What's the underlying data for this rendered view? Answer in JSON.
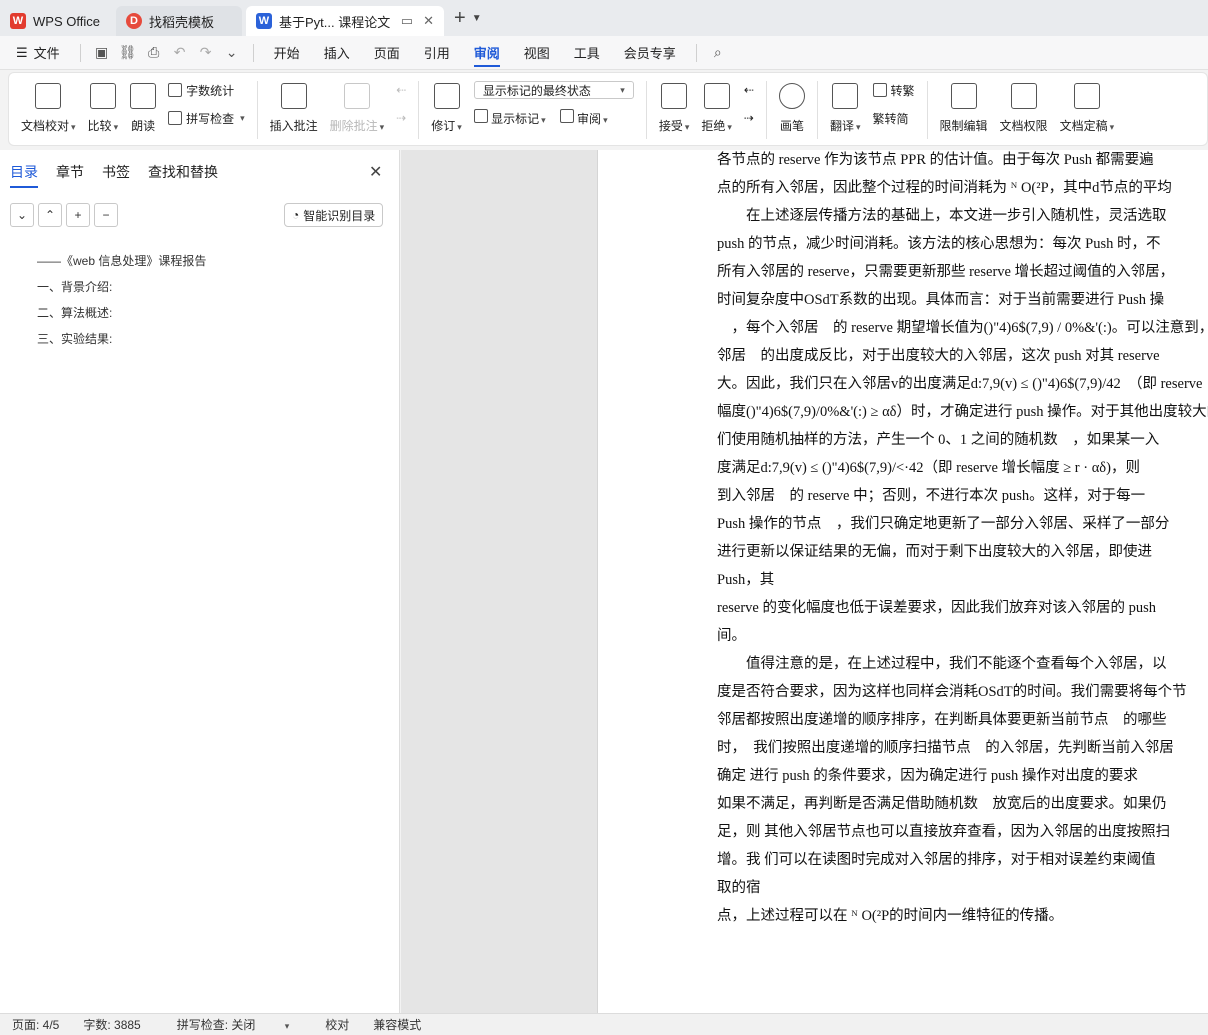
{
  "titlebar": {
    "app_tab": "WPS Office",
    "template_tab": "找稻壳模板",
    "doc_tab": "基于Pyt... 课程论文"
  },
  "menu": {
    "file": "文件",
    "items": [
      "开始",
      "插入",
      "页面",
      "引用",
      "审阅",
      "视图",
      "工具",
      "会员专享"
    ],
    "active": "审阅"
  },
  "ribbon": {
    "doc_check": "文档校对",
    "compare": "比较",
    "read_aloud": "朗读",
    "word_count": "字数统计",
    "spell_check": "拼写检查",
    "insert_comment": "插入批注",
    "delete_comment": "删除批注",
    "track_changes": "修订",
    "display_mode": "显示标记的最终状态",
    "show_markup": "显示标记",
    "reviewing_pane": "审阅",
    "accept": "接受",
    "reject": "拒绝",
    "ink": "画笔",
    "translate": "翻译",
    "to_traditional": "转繁",
    "to_simplified": "繁转简",
    "restrict_edit": "限制编辑",
    "doc_permission": "文档权限",
    "finalize": "文档定稿"
  },
  "nav_pane": {
    "tabs": [
      "目录",
      "章节",
      "书签",
      "查找和替换"
    ],
    "smart_toc": "智能识别目录",
    "toc": [
      "——《web 信息处理》课程报告",
      "一、背景介绍:",
      "二、算法概述:",
      "三、实验结果:"
    ]
  },
  "document": {
    "lines": [
      "各节点的 reserve 作为该节点 PPR 的估计值。由于每次 Push 都需要遍",
      "点的所有入邻居，因此整个过程的时间消耗为 ᴺ O(²P，其中d节点的平均",
      "　　在上述逐层传播方法的基础上，本文进一步引入随机性，灵活选取",
      "push 的节点，减少时间消耗。该方法的核心思想为：每次 Push 时，不",
      "所有入邻居的 reserve，只需要更新那些 reserve 增长超过阈值的入邻居，",
      "时间复杂度中OSdT系数的出现。具体而言：对于当前需要进行 Push 操",
      "　，每个入邻居　的 reserve 期望增长值为()\"4)6$(7,9) / 0%&'(:)。可以注意到，该增",
      "邻居　的出度成反比，对于出度较大的入邻居，这次 push 对其 reserve",
      "大。因此，我们只在入邻居v的出度满足d:7,9(v) ≤ ()\"4)6$(7,9)/42　（即 reserve",
      "幅度()\"4)6$(7,9)/0%&'(:) ≥ αδ）时，才确定进行 push 操作。对于其他出度较大的节",
      "们使用随机抽样的方法，产生一个 0、1 之间的随机数　，如果某一入",
      "度满足d:7,9(v) ≤ ()\"4)6$(7,9)/<·42（即 reserve 增长幅度 ≥ r · αδ)，则",
      "到入邻居　的 reserve 中；否则，不进行本次 push。这样，对于每一",
      "Push 操作的节点　，我们只确定地更新了一部分入邻居、采样了一部分",
      "进行更新以保证结果的无偏，而对于剩下出度较大的入邻居，即使进",
      "Push，其",
      "reserve 的变化幅度也低于误差要求，因此我们放弃对该入邻居的 push",
      "间。",
      "　　值得注意的是，在上述过程中，我们不能逐个查看每个入邻居，以",
      "度是否符合要求，因为这样也同样会消耗OSdT的时间。我们需要将每个节",
      "邻居都按照出度递增的顺序排序，在判断具体要更新当前节点　的哪些",
      "时，　我们按照出度递增的顺序扫描节点　的入邻居，先判断当前入邻居",
      "确定 进行 push 的条件要求，因为确定进行 push 操作对出度的要求",
      "如果不满足，再判断是否满足借助随机数　放宽后的出度要求。如果仍",
      "足，则 其他入邻居节点也可以直接放弃查看，因为入邻居的出度按照扫",
      "增。我 们可以在读图时完成对入邻居的排序，对于相对误差约束阈值",
      "取的宿",
      "点，上述过程可以在 ᴺ O(²P的时间内一维特征的传播。"
    ]
  },
  "status": {
    "page": "页面: 4/5",
    "words": "字数: 3885",
    "spell": "拼写检查: 关闭",
    "proof": "校对",
    "compat": "兼容模式"
  }
}
